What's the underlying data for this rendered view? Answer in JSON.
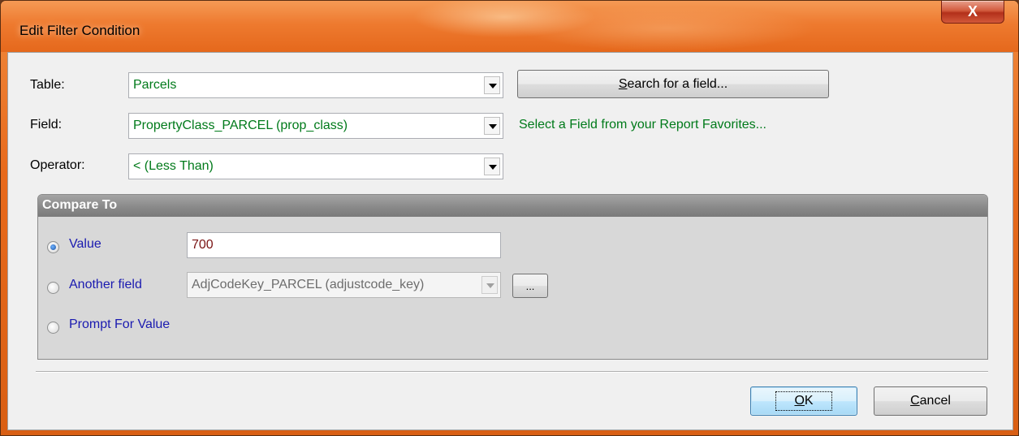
{
  "window": {
    "title": "Edit Filter Condition",
    "close_label": "X"
  },
  "form": {
    "table_label": "Table:",
    "table_value": "Parcels",
    "field_label": "Field:",
    "field_value": "PropertyClass_PARCEL (prop_class)",
    "operator_label": "Operator:",
    "operator_value": "< (Less Than)",
    "search_button_pre": "",
    "search_button_underline": "S",
    "search_button_post": "earch for a field...",
    "favorites_link": "Select a Field from your Report Favorites..."
  },
  "compare": {
    "header": "Compare To",
    "value_label": "Value",
    "value_input": "700",
    "another_field_label": "Another field",
    "another_field_value": "AdjCodeKey_PARCEL (adjustcode_key)",
    "ellipsis_button": "...",
    "prompt_label": "Prompt For Value",
    "selected": "Value"
  },
  "buttons": {
    "ok_underline": "O",
    "ok_rest": "K",
    "cancel_underline": "C",
    "cancel_rest": "ancel"
  },
  "colors": {
    "titlebar": "#ee7a2f",
    "field_text": "#007a1a",
    "radio_text": "#1a1ab0",
    "value_text": "#7a1414"
  }
}
